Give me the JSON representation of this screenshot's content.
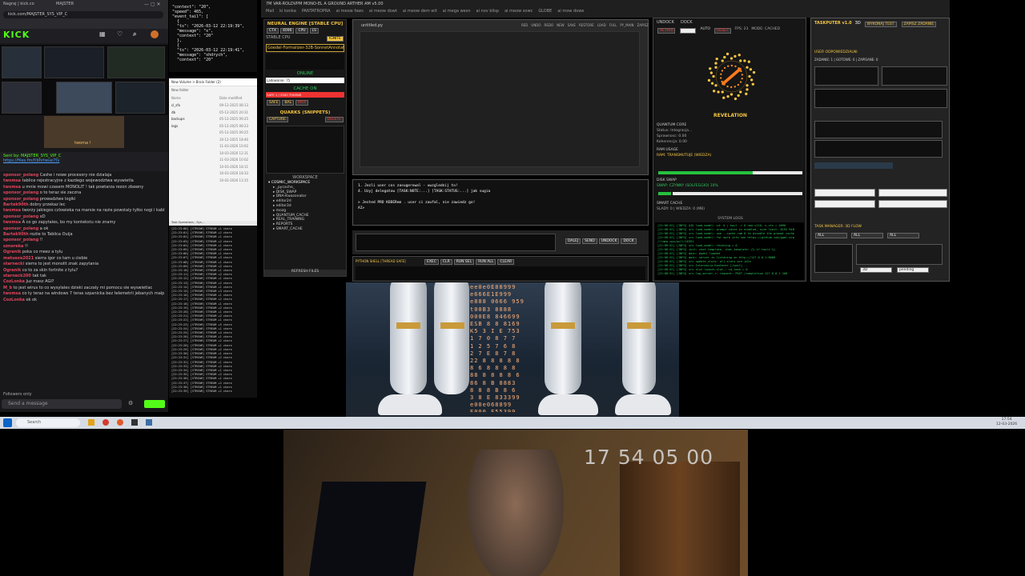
{
  "browser": {
    "tab1": "Nagraj | kick.co",
    "tab2": "MAJSTER",
    "address": "kick.com/MAJSTER_SYS_VIP_C"
  },
  "twitch": {
    "logo": "KICK",
    "sent_by": "Sent by: MAJSTER_SYS_VIP_C",
    "link": "https://files.fm/f/bhrtwue7tv",
    "cam_label": "twoma !",
    "chat": [
      {
        "user": "sponsor_polang",
        "text": "Cashe i nowe procesory nie dzialaja"
      },
      {
        "user": "twomsa",
        "text": "tablice rejestracyjne z kazdego wojewodztwa wyswietla"
      },
      {
        "user": "twomsa",
        "text": "u mnie mowi czasem MONOLIT ! tak powtarza rezon zbawny"
      },
      {
        "user": "sponsor_polang",
        "text": "o to teraz sie zaczna"
      },
      {
        "user": "sponsor_polang",
        "text": "prowadziwe logiki"
      },
      {
        "user": "Bartek90th",
        "text": "dobry przekaz lec"
      },
      {
        "user": "twomsa",
        "text": "tworzy jakiegos czlowieka na marsie na razie powstaly tylko nogi i kablie czekajmy dalej"
      },
      {
        "user": "sponsor_polang",
        "text": "xD"
      },
      {
        "user": "twomsa",
        "text": "A co go zapytales, bo my kontekstu nie znamy"
      },
      {
        "user": "sponsor_polang",
        "text": "a ok"
      },
      {
        "user": "Bartek90th",
        "text": "roziie to Tablica Ouija"
      },
      {
        "user": "sponsor_polang",
        "text": "!!"
      },
      {
        "user": "sznereka",
        "text": "!!"
      },
      {
        "user": "Ogranik",
        "text": "poka co meez a tylu"
      },
      {
        "user": "matueze2021",
        "text": "sierra igor co tam u ciebie"
      },
      {
        "user": "starnecki",
        "text": "sierra to jest monolit znak zapytania"
      },
      {
        "user": "Ogranik",
        "text": "co to za skin fortnite z tylu?"
      },
      {
        "user": "starneck200",
        "text": "tak tak"
      },
      {
        "user": "CozLonka",
        "text": "Juz masz AGI?"
      },
      {
        "user": "M_b",
        "text": "to jest wirus to co wysylales dzieki zaczaly mi pomocu sie wyswietlac"
      },
      {
        "user": "twomsa",
        "text": "co ty teraz na windows 7 teras szpanicka bez telemetrii jebanych malp z microsoftu"
      },
      {
        "user": "CozLonka",
        "text": "ok ok"
      }
    ],
    "followers_only": "Followers only",
    "send_placeholder": "Send a message"
  },
  "json_window": {
    "lines": [
      "\"context\": \"20\",",
      "\"speed\": 465,",
      "\"event_tail\": [",
      "  {",
      "  \"ts\": \"2026-03-12 22:19:39\",",
      "  \"message\": \"x\",",
      "  \"context\": \"20\"",
      "  },",
      "  {",
      "  \"ts\": \"2026-03-12 22:19:41\",",
      "  \"message\": \"xhdrych\",",
      "  \"context\": \"20\""
    ]
  },
  "explorer": {
    "path": "New Volume > Brain Folder (2)",
    "new_folder": "New folder",
    "header_name": "Name",
    "header_date": "Date modified",
    "rows": [
      {
        "name": "cl_sfx",
        "date": "09-12-2025 08:13"
      },
      {
        "name": "db",
        "date": "05-12-2025 20:31"
      },
      {
        "name": "backups",
        "date": "05-12-2025 09:25"
      },
      {
        "name": "logs",
        "date": "05-12-2025 08:23"
      },
      {
        "name": "",
        "date": "05-12-2025 09:25"
      },
      {
        "name": "",
        "date": "10-12-2025 18:40"
      },
      {
        "name": "",
        "date": "11-03-2026 10:02"
      },
      {
        "name": "",
        "date": "10-03-2026 12:31"
      },
      {
        "name": "",
        "date": "11-03-2026 10:02"
      },
      {
        "name": "",
        "date": "10-03-2026 18:11"
      },
      {
        "name": "",
        "date": "10-03-2026 18:33"
      },
      {
        "name": "",
        "date": "10-02-2026 13:15"
      }
    ]
  },
  "console": {
    "title": "Task Operations - Sys...",
    "lines": [
      "[22:23:00] [STREAM] STREAM +1 chars",
      "[22:23:01] [STREAM] STREAM +2 chars",
      "[22:23:02] [STREAM] STREAM +1 chars",
      "[22:23:03] [STREAM] STREAM +2 chars",
      "[22:23:04] [STREAM] STREAM +1 chars",
      "[22:23:05] [STREAM] STREAM +2 chars",
      "[22:23:06] [STREAM] STREAM +1 chars",
      "[22:23:07] [STREAM] STREAM +3 chars",
      "[22:23:08] [STREAM] STREAM +1 chars",
      "[22:23:09] [STREAM] STREAM +2 chars",
      "[22:23:10] [STREAM] STREAM +1 chars",
      "[22:23:11] [STREAM] STREAM +2 chars",
      "[22:23:12] [STREAM] STREAM +1 chars",
      "[22:23:13] [STREAM] STREAM +2 chars",
      "[22:23:14] [STREAM] STREAM +1 chars",
      "[22:23:15] [STREAM] STREAM +3 chars",
      "[22:23:16] [STREAM] STREAM +1 chars",
      "[22:23:17] [STREAM] STREAM +2 chars",
      "[22:23:18] [STREAM] STREAM +1 chars",
      "[22:23:19] [STREAM] STREAM +2 chars",
      "[22:23:20] [STREAM] STREAM +1 chars",
      "[22:23:21] [STREAM] STREAM +2 chars",
      "[22:23:22] [STREAM] STREAM +1 chars",
      "[22:23:23] [STREAM] STREAM +5 chars",
      "[22:23:24] [STREAM] STREAM +1 chars",
      "[22:23:25] [STREAM] STREAM +4 chars",
      "[22:23:26] [STREAM] STREAM +1 chars",
      "[22:23:27] [STREAM] STREAM +2 chars",
      "[22:23:28] [STREAM] STREAM +1 chars",
      "[22:23:29] [STREAM] STREAM +2 chars",
      "[22:23:30] [STREAM] STREAM +1 chars",
      "[22:23:31] [STREAM] STREAM +2 chars",
      "[22:23:32] [STREAM] STREAM +1 chars",
      "[22:23:33] [STREAM] STREAM +2 chars",
      "[22:23:34] [STREAM] STREAM +1 chars",
      "[22:23:35] [STREAM] STREAM +2 chars",
      "[22:23:36] [STREAM] STREAM +1 chars",
      "[22:23:37] [STREAM] STREAM +2 chars",
      "[22:23:38] [STREAM] STREAM +1 chars",
      "[22:23:39] [STREAM] STREAM +2 chars"
    ]
  },
  "tabs_bar": {
    "title": "7M VAR-ROLDVPM MONO-EL A GROUND ARTHER AM v5.00",
    "items": [
      "Mail",
      "ki konka",
      "PANTATROPRA",
      "ai meow faws",
      "ai meow dowt",
      "ai meow dem wit",
      "ai mega wesn",
      "ai nov blisp",
      "ai meow sowc",
      "GLOBE",
      "ai mow dowe"
    ]
  },
  "neural": {
    "title": "NEURAL ENGINE [STABLE CPU]",
    "btn1": "CTX",
    "btn2": "4096",
    "btn3": "CPU",
    "btn4": "LS",
    "stable": "STABLE CPU",
    "ignite": "IGNITE",
    "model": "Goedel-Formalizer-32B-SonnetAnnotated",
    "online": "ONLINE",
    "loaded": "Ladowanie: 75",
    "cache": "CACHE ON",
    "cache_info": "SAFE 1 / 2500 TOKENS",
    "safe": "SAFE",
    "bal": "BAL",
    "max": "MAX",
    "quarks": "QUARKS (SNIPPETS)",
    "capture": "CAPTURE",
    "delete": "DELETE",
    "workspace": "WORKSPACE",
    "tree": [
      "COSMIC_WORKSPACE",
      "_pycache_",
      "DISK_SWAP",
      "DNA-Kwazonator",
      "editor2d",
      "editor3d",
      "mozg",
      "QUANTUM_CACHE",
      "REAL_TRAINING",
      "REPORTS",
      "SMART_CACHE"
    ],
    "refresh": "REFRESH FILES"
  },
  "editor": {
    "filename": "untitled.py",
    "toolbar": [
      "RED",
      "UNDO",
      "REDO",
      "NEW",
      "SAVE",
      "RESTORE",
      "LOAD",
      "FULL",
      "PY_MAIN",
      "ZAPISZ"
    ],
    "prompt_lines": [
      "1. Jezli user cos zasugerowal - uwzglednij to!",
      "4. Uzyj delegatow [TASK:NOTE:...] [TASK:STATUS:...] jak sugia",
      "",
      "> Jested PRO KODERem . user ci zaufal, nie zawiedz go!",
      "AI>"
    ],
    "btn_next": "DALEJ",
    "btn_send": "SEND",
    "btn_undock": "UNDOCK",
    "btn_dock": "DOCK",
    "status": "PYTHON SHELL [THREAD SAFE]",
    "status_btns": [
      "EXEC",
      "CLR",
      "RUN SEL",
      "RUN ALL",
      "CLEAR"
    ]
  },
  "undock": {
    "tab1": "UNDOCK",
    "tab2": "DOCK",
    "btn_actrix": "ACTRIX",
    "auto": "AUTO",
    "reset": "RESET",
    "fps": "FPS: 23",
    "mode": "MODE: CACHED",
    "revelation": "REVELATION",
    "quantum": "QUANTUM CORE",
    "status": "Status: Integracja...",
    "sprawnosc": "Sprawnosc: 0.00",
    "koherencja": "Koherencja: 0.00",
    "ram": "RAM USAGE",
    "ram_bar": "RAM: TRANSMUTUJE (WIEDZA)",
    "disk": "DISK SWAP",
    "swap": "SWAP: CZYNNY (SOLFEGGIO) 10%",
    "smart": "SMART CACHE",
    "slady": "SLADY: 0 | WIEDZA: 0 (MB)",
    "syslog_title": "SYSTEM LOGS",
    "syslog": [
      "[22:08:52] [INFO] AIO load_model: id: 0 | kavl -> 0 new x110, n_ctx = 4096",
      "[22:08:52] [INFO] srv  load_model: prompt cache is enabled, size limit: 8192 MiB",
      "[22:08:52] [INFO] srv  load_model: use --cache-ram 0 to disable the prompt cache",
      "[22:08:52] [INFO] srv  load_model: for more info see https://github.com/ggml-org",
      "/llama.cpp/pull/16391",
      "[22:08:52] [INFO] srv  load_model: thinking = 0",
      "[22:08:52] [INFO] init: chat template, chat_template: {% if tools %}",
      "[22:08:52] [INFO] main: model loaded",
      "[22:08:52] [INFO] main: server is listening on http://127.0.0.1:8080",
      "[22:08:52] [INFO] srv  update_slots: all slots are idle",
      "[22:08:52] [INFO] srv  Interakcja Kontener [/wait]...",
      "[22:08:52] [INFO] srv  slot launch_slot_: id_task = 0",
      "[22:08:52] [INFO] srv  log_server_r: request: POST /completion 127.0.0.1 200"
    ]
  },
  "taskputer": {
    "title": "TASKPUTER v1.0",
    "mode": "3D",
    "btn1": "WYKONAJ TEST",
    "btn2": "ZAPISZ ZADANIE",
    "user": "USER ODPOWIEDZIALNI",
    "stats": "ZADANIE: 1 | GOTOWE: 0 | ZAPISANE: 0",
    "tasks": "TASK MANAGER: 3D FLOW",
    "all1": "ALL",
    "all2": "ALL",
    "all3": "ALL",
    "field": "3D",
    "pending": "pending"
  },
  "video": {
    "numbers": [
      "ee0e0E88999",
      "e666E1E999",
      "e888 0666 959",
      "t00B3 8888",
      "000E8 846699",
      "ESB 8 8 8169",
      "K5 3 I E 753",
      "1 7 0 8 7 7",
      "1 2 5 7 6 8",
      "2 7 E 8 7 8",
      "22 8 8 8 8 8",
      "8 6 8 8 8 8",
      "88 8 8 8 8 6",
      "86 8 B 8883",
      "8 8 8 B 8 6",
      "3 8 E 833399",
      "e00e068899",
      "E000 E55399",
      "e0e B88999"
    ]
  },
  "taskbar": {
    "search": "Search",
    "time": "17:54",
    "date": "12-03-2026"
  },
  "webcam": {
    "timecode": "17 54 05 00"
  }
}
